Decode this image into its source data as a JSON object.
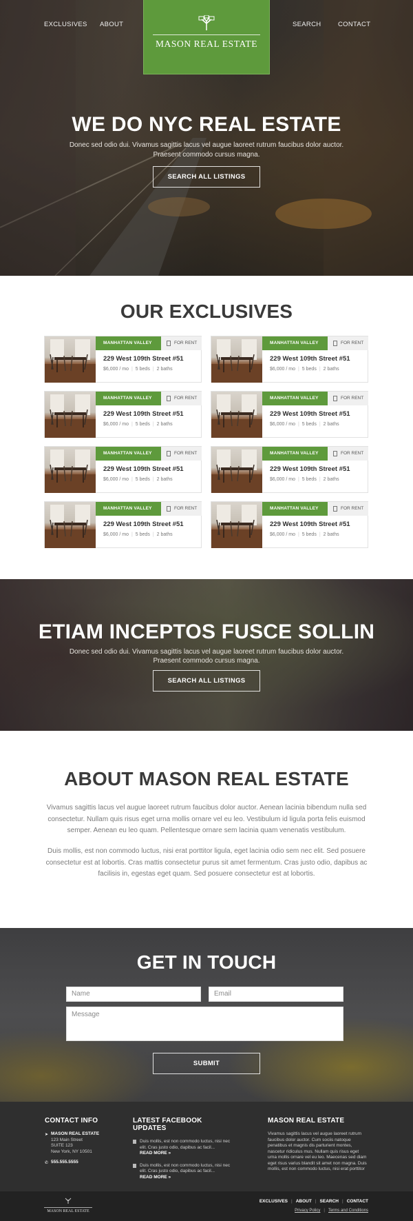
{
  "nav": {
    "exclusives": "EXCLUSIVES",
    "about": "ABOUT",
    "search": "SEARCH",
    "contact": "CONTACT",
    "logo_text": "MASON REAL ESTATE",
    "logo_icon": "tree-icon"
  },
  "hero": {
    "title": "WE DO NYC REAL ESTATE",
    "subtitle": "Donec sed odio dui. Vivamus sagittis lacus vel augue laoreet rutrum faucibus dolor auctor. Praesent commodo cursus magna.",
    "button": "SEARCH ALL LISTINGS"
  },
  "exclusives": {
    "title": "OUR EXCLUSIVES",
    "listings": [
      {
        "neighborhood": "MANHATTAN VALLEY",
        "status": "FOR RENT",
        "address": "229 West 109th Street #51",
        "price": "$6,000 / mo",
        "beds": "5 beds",
        "baths": "2 baths"
      },
      {
        "neighborhood": "MANHATTAN VALLEY",
        "status": "FOR RENT",
        "address": "229 West 109th Street #51",
        "price": "$6,000 / mo",
        "beds": "5 beds",
        "baths": "2 baths"
      },
      {
        "neighborhood": "MANHATTAN VALLEY",
        "status": "FOR RENT",
        "address": "229 West 109th Street #51",
        "price": "$6,000 / mo",
        "beds": "5 beds",
        "baths": "2 baths"
      },
      {
        "neighborhood": "MANHATTAN VALLEY",
        "status": "FOR RENT",
        "address": "229 West 109th Street #51",
        "price": "$6,000 / mo",
        "beds": "5 beds",
        "baths": "2 baths"
      },
      {
        "neighborhood": "MANHATTAN VALLEY",
        "status": "FOR RENT",
        "address": "229 West 109th Street #51",
        "price": "$6,000 / mo",
        "beds": "5 beds",
        "baths": "2 baths"
      },
      {
        "neighborhood": "MANHATTAN VALLEY",
        "status": "FOR RENT",
        "address": "229 West 109th Street #51",
        "price": "$6,000 / mo",
        "beds": "5 beds",
        "baths": "2 baths"
      },
      {
        "neighborhood": "MANHATTAN VALLEY",
        "status": "FOR RENT",
        "address": "229 West 109th Street #51",
        "price": "$6,000 / mo",
        "beds": "5 beds",
        "baths": "2 baths"
      },
      {
        "neighborhood": "MANHATTAN VALLEY",
        "status": "FOR RENT",
        "address": "229 West 109th Street #51",
        "price": "$6,000 / mo",
        "beds": "5 beds",
        "baths": "2 baths"
      }
    ]
  },
  "banner": {
    "title": "ETIAM INCEPTOS FUSCE SOLLIN",
    "subtitle": "Donec sed odio dui. Vivamus sagittis lacus vel augue laoreet rutrum faucibus dolor auctor. Praesent commodo cursus magna.",
    "button": "SEARCH ALL LISTINGS"
  },
  "about": {
    "title": "ABOUT MASON REAL ESTATE",
    "p1": "Vivamus sagittis lacus vel augue laoreet rutrum faucibus dolor auctor. Aenean lacinia bibendum nulla sed consectetur. Nullam quis risus eget urna mollis ornare vel eu leo. Vestibulum id ligula porta felis euismod semper. Aenean eu leo quam. Pellentesque ornare sem lacinia quam venenatis vestibulum.",
    "p2": "Duis mollis, est non commodo luctus, nisi erat porttitor ligula, eget lacinia odio sem nec elit. Sed posuere consectetur est at lobortis. Cras mattis consectetur purus sit amet fermentum. Cras justo odio, dapibus ac facilisis in, egestas eget quam. Sed posuere consectetur est at lobortis."
  },
  "contact": {
    "title": "GET IN TOUCH",
    "name_placeholder": "Name",
    "email_placeholder": "Email",
    "message_placeholder": "Message",
    "submit": "SUBMIT"
  },
  "footer": {
    "contact_info": {
      "heading": "CONTACT INFO",
      "company": "MASON REAL ESTATE",
      "street": "123 Main Street",
      "suite": "SUITE 123",
      "city": "New York, NY 10501",
      "phone": "555.555.5555"
    },
    "facebook": {
      "heading": "LATEST FACEBOOK UPDATES",
      "posts": [
        {
          "text": "Duis mollis, est non commodo luctus, nisi nec elit. Cras justo odio, dapibus ac facil...",
          "link": "READ MORE »"
        },
        {
          "text": "Duis mollis, est non commodo luctus, nisi nec elit. Cras justo odio, dapibus ac facil...",
          "link": "READ MORE »"
        }
      ]
    },
    "about": {
      "heading": "MASON REAL ESTATE",
      "text": "Vivamus sagittis lacus vel augue laoreet rutrum faucibus dolor auctor. Cum sociis natoque penatibus et magnis dis parturient montes, nascetur ridiculus mus. Nullam quis risus eget urna mollis ornare vel eu leo. Maecenas sed diam eget risus varius blandit sit amet non magna. Duis mollis, est non commodo luctus, nisi erat porttitor"
    }
  },
  "subfooter": {
    "logo_text": "MASON REAL ESTATE",
    "links": [
      "EXCLUSIVES",
      "ABOUT",
      "SEARCH",
      "CONTACT"
    ],
    "privacy": "Privacy Policy",
    "terms": "Terms and Conditions"
  },
  "colors": {
    "brand_green": "#5e9a3c",
    "dark_footer": "#2f2f2f",
    "subfooter": "#222222"
  }
}
